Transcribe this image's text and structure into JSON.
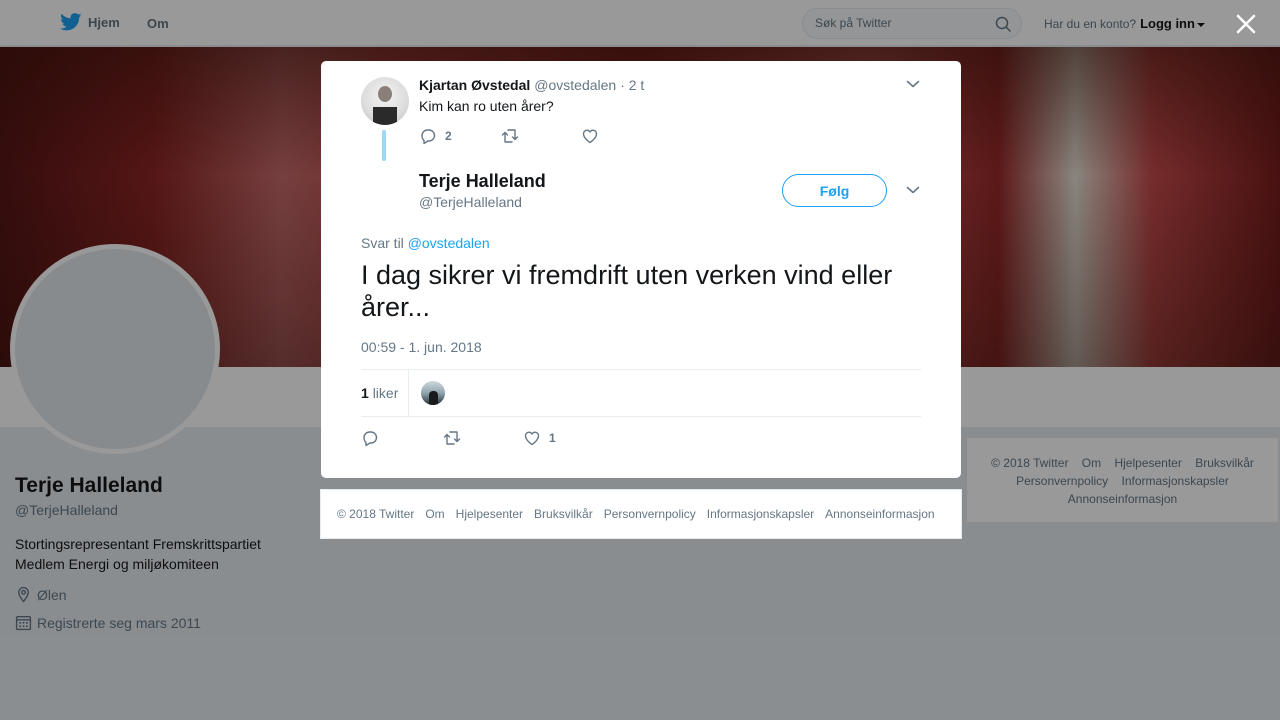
{
  "topbar": {
    "home_label": "Hjem",
    "about_label": "Om",
    "search_placeholder": "Søk på Twitter",
    "account_prompt": "Har du en konto?",
    "login_label": "Logg inn"
  },
  "profile": {
    "name": "Terje Halleland",
    "handle": "@TerjeHalleland",
    "bio_line1": "Stortingsrepresentant Fremskrittspartiet",
    "bio_line2": "Medlem Energi og miljøkomiteen",
    "location": "Ølen",
    "joined": "Registrerte seg mars 2011"
  },
  "side_footer": {
    "links": [
      "© 2018 Twitter",
      "Om",
      "Hjelpesenter",
      "Bruksvilkår",
      "Personvernpolicy",
      "Informasjonskapsler",
      "Annonseinformasjon"
    ]
  },
  "parent_tweet": {
    "name": "Kjartan Øvstedal",
    "handle": "@ovstedalen",
    "time": "· 2 t",
    "text": "Kim kan ro uten årer?",
    "reply_count": "2"
  },
  "main_tweet": {
    "name": "Terje Halleland",
    "handle": "@TerjeHalleland",
    "follow_label": "Følg",
    "reply_prefix": "Svar til",
    "reply_handle": "@ovstedalen",
    "text": "I dag sikrer vi fremdrift uten verken vind eller årer...",
    "timestamp": "00:59 - 1. jun. 2018",
    "likes_count": "1",
    "likes_label": "liker",
    "action_like_count": "1"
  },
  "modal_footer": {
    "links": [
      "© 2018 Twitter",
      "Om",
      "Hjelpesenter",
      "Bruksvilkår",
      "Personvernpolicy",
      "Informasjonskapsler",
      "Annonseinformasjon"
    ]
  },
  "colors": {
    "accent": "#1da1f2",
    "thread_line": "#9fd8f5",
    "muted_text": "#657786"
  }
}
